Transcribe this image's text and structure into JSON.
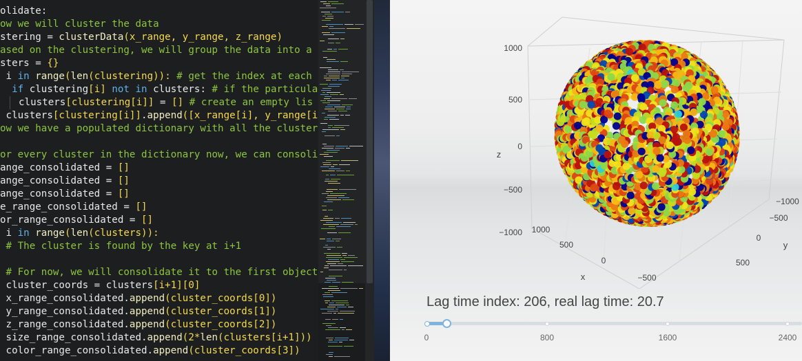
{
  "editor": {
    "lines": [
      [
        [
          "olidate:",
          "id"
        ]
      ],
      [
        [
          "ow we will cluster the data",
          "cm"
        ]
      ],
      [
        [
          "stering = ",
          "id"
        ],
        [
          "clusterData",
          "fn"
        ],
        [
          "(x_range, y_range, z_range)",
          "br"
        ]
      ],
      [
        [
          "ased on the clustering, we will group the data into a d",
          "cm"
        ]
      ],
      [
        [
          "sters = ",
          "id"
        ],
        [
          "{}",
          "br"
        ]
      ],
      [
        [
          " i ",
          "id"
        ],
        [
          "in",
          "kw"
        ],
        [
          " ",
          "id"
        ],
        [
          "range",
          "fn"
        ],
        [
          "(",
          "br"
        ],
        [
          "len",
          "fn"
        ],
        [
          "(clustering)",
          "br"
        ],
        [
          "): ",
          "br"
        ],
        [
          "# get the index at each c",
          "cm"
        ]
      ],
      [
        [
          "  ",
          "id"
        ],
        [
          "if",
          "kw"
        ],
        [
          " clustering",
          "id"
        ],
        [
          "[i]",
          "br"
        ],
        [
          " ",
          "id"
        ],
        [
          "not in",
          "kw"
        ],
        [
          " clusters: ",
          "id"
        ],
        [
          "# if the particular",
          "cm"
        ]
      ],
      [
        [
          "GUIDE",
          "guide"
        ],
        [
          "clusters",
          "id"
        ],
        [
          "[clustering[i]]",
          "br"
        ],
        [
          " = ",
          "id"
        ],
        [
          "[]",
          "br"
        ],
        [
          " ",
          "id"
        ],
        [
          "# create an empty lis",
          "cm"
        ]
      ],
      [
        [
          " clusters",
          "id"
        ],
        [
          "[clustering[i]]",
          "br"
        ],
        [
          ".",
          "id"
        ],
        [
          "append",
          "fn"
        ],
        [
          "([x_range[i], y_range[i]",
          "br"
        ]
      ],
      [
        [
          "ow we have a populated dictionary with all the clusters",
          "cm"
        ]
      ],
      [
        [
          "",
          "id"
        ]
      ],
      [
        [
          "or every cluster in the dictionary now, we can consolid",
          "cm"
        ]
      ],
      [
        [
          "ange_consolidated = ",
          "id"
        ],
        [
          "[]",
          "br"
        ]
      ],
      [
        [
          "ange_consolidated = ",
          "id"
        ],
        [
          "[]",
          "br"
        ]
      ],
      [
        [
          "ange_consolidated = ",
          "id"
        ],
        [
          "[]",
          "br"
        ]
      ],
      [
        [
          "e_range_consolidated = ",
          "id"
        ],
        [
          "[]",
          "br"
        ]
      ],
      [
        [
          "or_range_consolidated = ",
          "id"
        ],
        [
          "[]",
          "br"
        ]
      ],
      [
        [
          " i ",
          "id"
        ],
        [
          "in",
          "kw"
        ],
        [
          " ",
          "id"
        ],
        [
          "range",
          "fn"
        ],
        [
          "(",
          "br"
        ],
        [
          "len",
          "fn"
        ],
        [
          "(clusters)",
          "br"
        ],
        [
          "):",
          "br"
        ]
      ],
      [
        [
          " ",
          "id"
        ],
        [
          "# The cluster is found by the key at i+1",
          "cm"
        ]
      ],
      [
        [
          "",
          "id"
        ]
      ],
      [
        [
          " ",
          "id"
        ],
        [
          "# For now, we will consolidate it to the first object",
          "cm"
        ]
      ],
      [
        [
          " cluster_coords = clusters",
          "id"
        ],
        [
          "[i+1][0]",
          "br"
        ]
      ],
      [
        [
          " x_range_consolidated.",
          "id"
        ],
        [
          "append",
          "fn"
        ],
        [
          "(cluster_coords[0])",
          "br"
        ]
      ],
      [
        [
          " y_range_consolidated.",
          "id"
        ],
        [
          "append",
          "fn"
        ],
        [
          "(cluster_coords[1])",
          "br"
        ]
      ],
      [
        [
          " z_range_consolidated.",
          "id"
        ],
        [
          "append",
          "fn"
        ],
        [
          "(cluster_coords[2])",
          "br"
        ]
      ],
      [
        [
          " size_range_consolidated.",
          "id"
        ],
        [
          "append",
          "fn"
        ],
        [
          "(2*",
          "br"
        ],
        [
          "len",
          "fn"
        ],
        [
          "(clusters[i+1]))",
          "br"
        ]
      ],
      [
        [
          " color_range_consolidated.",
          "id"
        ],
        [
          "append",
          "fn"
        ],
        [
          "(cluster_coords[3])",
          "br"
        ]
      ]
    ]
  },
  "plot": {
    "z_axis": {
      "title": "z",
      "ticks": [
        "1000",
        "500",
        "0",
        "−500",
        "−1000"
      ]
    },
    "x_axis": {
      "title": "x",
      "ticks": [
        "1000",
        "500",
        "0",
        "−500"
      ]
    },
    "y_axis": {
      "title": "y",
      "ticks": [
        "−1000",
        "−500",
        "0",
        "500"
      ]
    },
    "colorscale": [
      "#00008f",
      "#0047b3",
      "#1a9fd8",
      "#2fd0d8",
      "#8cd84a",
      "#c4dc20",
      "#f0e21c",
      "#f5b616",
      "#ea7a12",
      "#dc4614",
      "#b8120e"
    ],
    "marker_count": 3200
  },
  "slider": {
    "label": "Lag time index: 206, real lag time: 20.7",
    "index": 206,
    "max": 3200,
    "step_labels": [
      "0",
      "800",
      "1600",
      "2400"
    ]
  },
  "colors": {
    "editor_bg": "#1c1e1f",
    "comment": "#8ec63f",
    "keyword": "#5fb2e8",
    "slider_accent": "#7fb5dc"
  }
}
